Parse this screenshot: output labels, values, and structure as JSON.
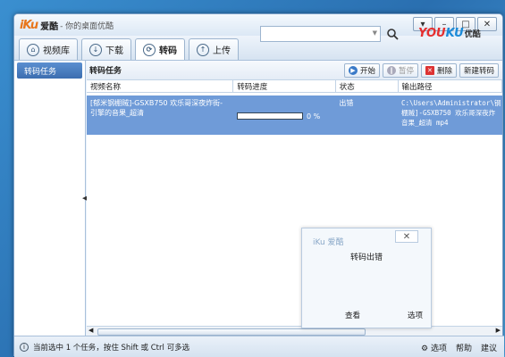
{
  "app": {
    "logo_latin": "iKu",
    "logo_cn": "爱酷",
    "slogan": "- 你的桌面优酷"
  },
  "window_buttons": {
    "menu": "▾",
    "minimize": "–",
    "maximize": "□",
    "close": "✕"
  },
  "tabs": [
    {
      "label": "视频库",
      "icon": "home-icon"
    },
    {
      "label": "下载",
      "icon": "download-icon"
    },
    {
      "label": "转码",
      "icon": "transcode-icon",
      "active": true
    },
    {
      "label": "上传",
      "icon": "upload-icon"
    }
  ],
  "search": {
    "placeholder": "",
    "button_icon": "search-icon"
  },
  "brand": {
    "you": "YOU",
    "ku": "KU",
    "cn": "优酷"
  },
  "sidebar": {
    "items": [
      {
        "label": "转码任务"
      }
    ]
  },
  "main": {
    "title": "转码任务",
    "actions": {
      "start": "开始",
      "pause": "暂停",
      "delete": "删除",
      "new": "新建转码"
    },
    "columns": [
      "视频名称",
      "转码进度",
      "状态",
      "输出路径"
    ],
    "rows": [
      {
        "name": "[郁米钢棚贼]-GSXB750 欢乐哥深夜炸街-引擎的音果_超清",
        "progress": 0,
        "progress_text": "0 %",
        "status": "出错",
        "output": "C:\\Users\\Administrator\\钢棚贼]-GSXB750 欢乐哥深夜炸音果_超清 mp4"
      }
    ]
  },
  "statusbar": {
    "message": "当前选中 1 个任务，按住 Shift 或 Ctrl 可多选",
    "options": "选项",
    "help": "帮助",
    "suggest": "建议"
  },
  "dialog": {
    "title": "iKu 爱酷",
    "close": "✕",
    "message": "转码出错",
    "button_view": "查看",
    "button_options": "选项"
  }
}
